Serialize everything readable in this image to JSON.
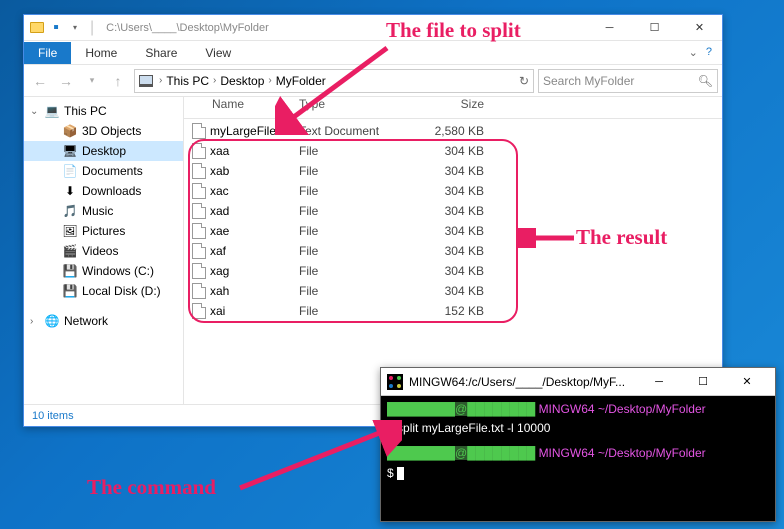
{
  "explorer": {
    "titlePath": "C:\\Users\\____\\Desktop\\MyFolder",
    "ribbon": {
      "file": "File",
      "home": "Home",
      "share": "Share",
      "view": "View"
    },
    "breadcrumb": [
      "This PC",
      "Desktop",
      "MyFolder"
    ],
    "searchPlaceholder": "Search MyFolder",
    "sidebar": [
      {
        "label": "This PC",
        "icon": "pc",
        "expanded": true,
        "indent": false
      },
      {
        "label": "3D Objects",
        "icon": "3d",
        "indent": true
      },
      {
        "label": "Desktop",
        "icon": "desktop",
        "indent": true,
        "selected": true
      },
      {
        "label": "Documents",
        "icon": "docs",
        "indent": true
      },
      {
        "label": "Downloads",
        "icon": "downloads",
        "indent": true
      },
      {
        "label": "Music",
        "icon": "music",
        "indent": true
      },
      {
        "label": "Pictures",
        "icon": "pictures",
        "indent": true
      },
      {
        "label": "Videos",
        "icon": "videos",
        "indent": true
      },
      {
        "label": "Windows (C:)",
        "icon": "drive",
        "indent": true
      },
      {
        "label": "Local Disk (D:)",
        "icon": "drive",
        "indent": true
      },
      {
        "label": "Network",
        "icon": "network",
        "indent": false,
        "gap": true
      }
    ],
    "columns": {
      "name": "Name",
      "type": "Type",
      "size": "Size"
    },
    "files": [
      {
        "name": "myLargeFile",
        "type": "Text Document",
        "size": "2,580 KB"
      },
      {
        "name": "xaa",
        "type": "File",
        "size": "304 KB"
      },
      {
        "name": "xab",
        "type": "File",
        "size": "304 KB"
      },
      {
        "name": "xac",
        "type": "File",
        "size": "304 KB"
      },
      {
        "name": "xad",
        "type": "File",
        "size": "304 KB"
      },
      {
        "name": "xae",
        "type": "File",
        "size": "304 KB"
      },
      {
        "name": "xaf",
        "type": "File",
        "size": "304 KB"
      },
      {
        "name": "xag",
        "type": "File",
        "size": "304 KB"
      },
      {
        "name": "xah",
        "type": "File",
        "size": "304 KB"
      },
      {
        "name": "xai",
        "type": "File",
        "size": "152 KB"
      }
    ],
    "status": "10 items"
  },
  "terminal": {
    "title": "MINGW64:/c/Users/____/Desktop/MyF...",
    "promptPath": "MINGW64 ~/Desktop/MyFolder",
    "command": "split myLargeFile.txt -l 10000",
    "promptChar": "$"
  },
  "annotations": {
    "fileToSplit": "The file to split",
    "result": "The result",
    "command": "The command"
  }
}
